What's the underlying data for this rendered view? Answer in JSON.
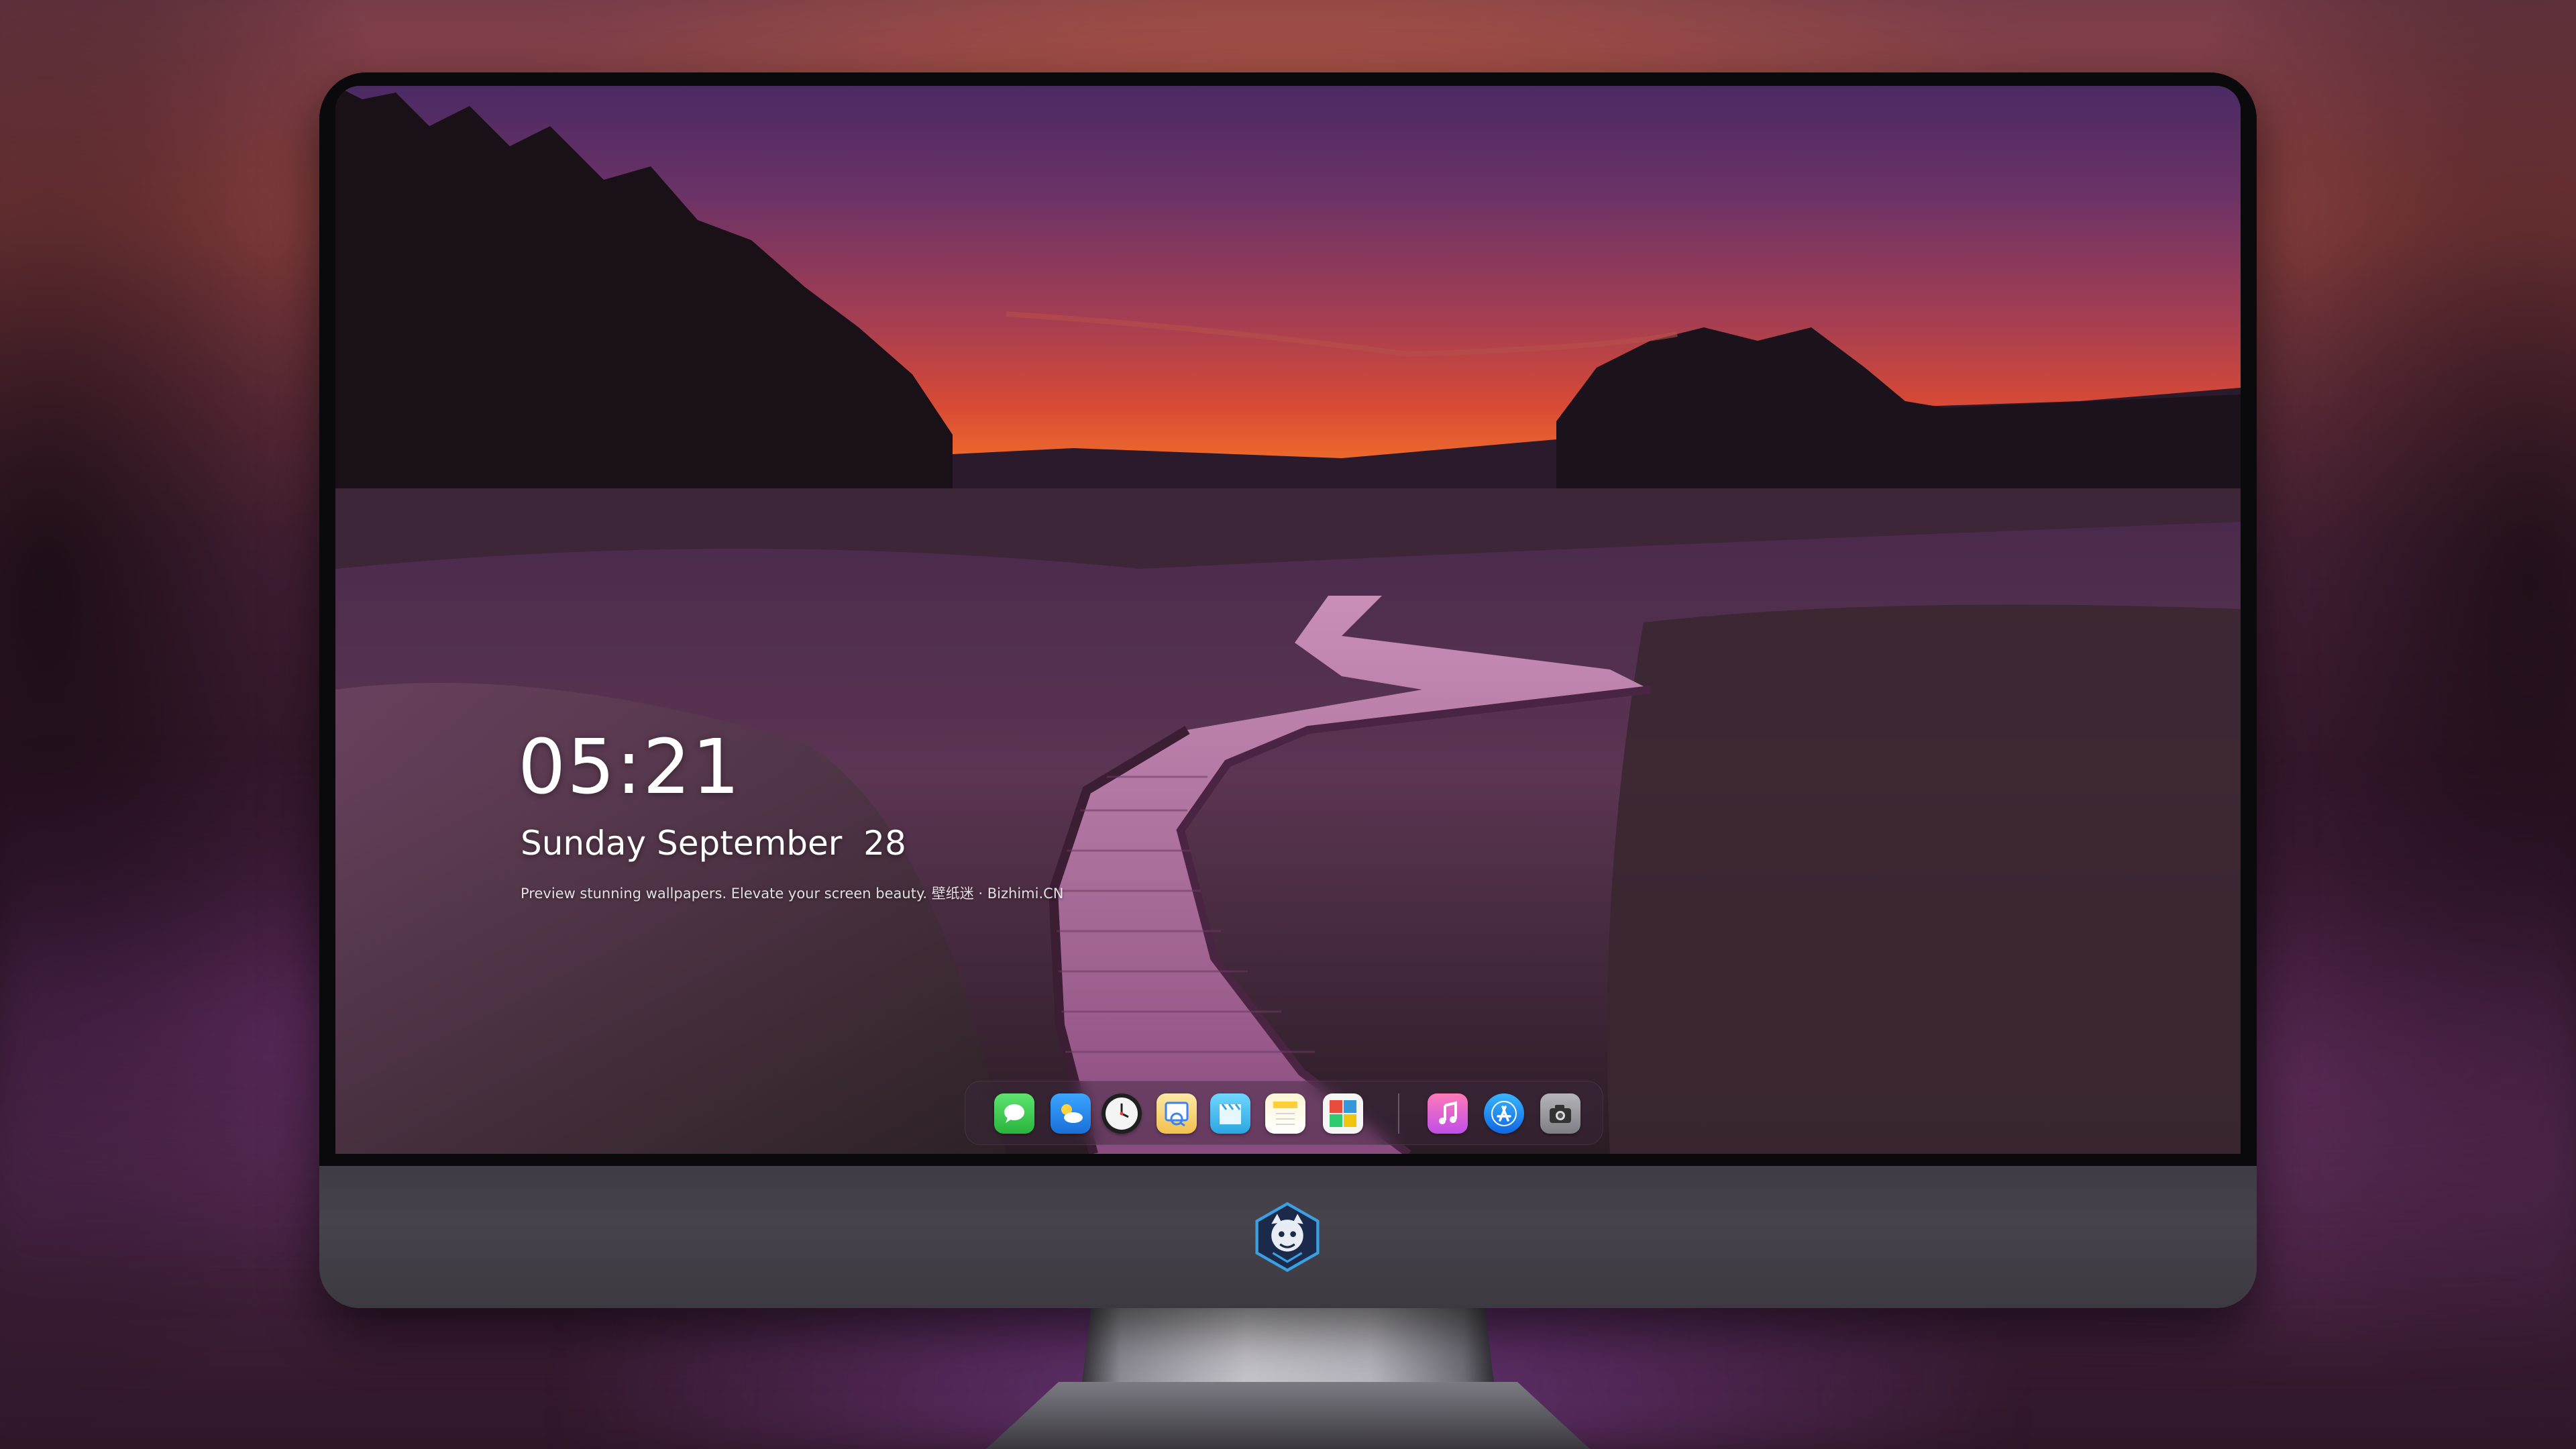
{
  "lockscreen": {
    "time": "05:21",
    "date": "Sunday September  28",
    "tagline": "Preview stunning wallpapers. Elevate your screen beauty. 壁纸迷 · Bizhimi.CN"
  },
  "dock": {
    "items": [
      {
        "id": "messages",
        "icon": "messages-icon",
        "color": "#34c759"
      },
      {
        "id": "weather",
        "icon": "weather-icon",
        "color": "#1e90ff"
      },
      {
        "id": "clock",
        "icon": "clock-icon",
        "color": "#f2f2f2"
      },
      {
        "id": "preview",
        "icon": "preview-icon",
        "color": "#f4c542"
      },
      {
        "id": "clips",
        "icon": "clapperboard-icon",
        "color": "#4fc3f7"
      },
      {
        "id": "notes",
        "icon": "notes-icon",
        "color": "#ffd54f"
      },
      {
        "id": "photo-booth",
        "icon": "photo-booth-icon",
        "color": "#8bc34a"
      },
      {
        "id": "music",
        "icon": "music-icon",
        "color": "#f06292"
      },
      {
        "id": "app-store",
        "icon": "app-store-icon",
        "color": "#2196f3"
      },
      {
        "id": "camera",
        "icon": "camera-icon",
        "color": "#8e8e93"
      }
    ]
  },
  "colors": {
    "sky_top": "#4b2a63",
    "sky_horizon": "#f3901f",
    "chin": "#47434c",
    "bezel": "#0a0a0d"
  }
}
